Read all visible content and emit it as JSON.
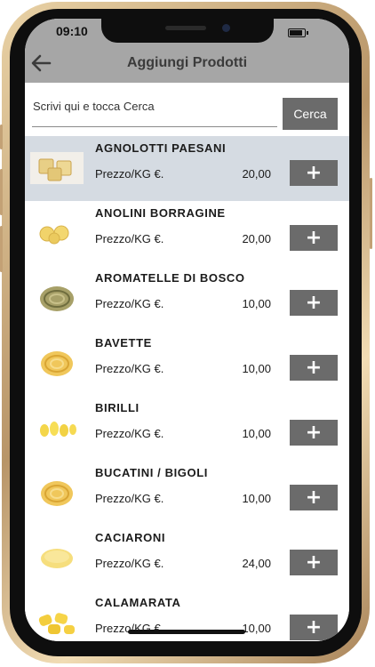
{
  "status_bar": {
    "time": "09:10"
  },
  "app_bar": {
    "title": "Aggiungi Prodotti"
  },
  "search": {
    "placeholder": "Scrivi qui e tocca Cerca",
    "button_label": "Cerca"
  },
  "price_label": "Prezzo/KG €.",
  "add_button_label": "+",
  "products": [
    {
      "name": "AGNOLOTTI PAESANI",
      "price": "20,00",
      "selected": true,
      "thumb": "agnolotti"
    },
    {
      "name": "ANOLINI BORRAGINE",
      "price": "20,00",
      "selected": false,
      "thumb": "anolini"
    },
    {
      "name": "AROMATELLE DI BOSCO",
      "price": "10,00",
      "selected": false,
      "thumb": "nest-green"
    },
    {
      "name": "BAVETTE",
      "price": "10,00",
      "selected": false,
      "thumb": "nest-yellow"
    },
    {
      "name": "BIRILLI",
      "price": "10,00",
      "selected": false,
      "thumb": "birilli"
    },
    {
      "name": "BUCATINI / BIGOLI",
      "price": "10,00",
      "selected": false,
      "thumb": "nest-yellow"
    },
    {
      "name": "CACIARONI",
      "price": "24,00",
      "selected": false,
      "thumb": "caciaroni"
    },
    {
      "name": "CALAMARATA",
      "price": "10,00",
      "selected": false,
      "thumb": "calamarata"
    }
  ]
}
